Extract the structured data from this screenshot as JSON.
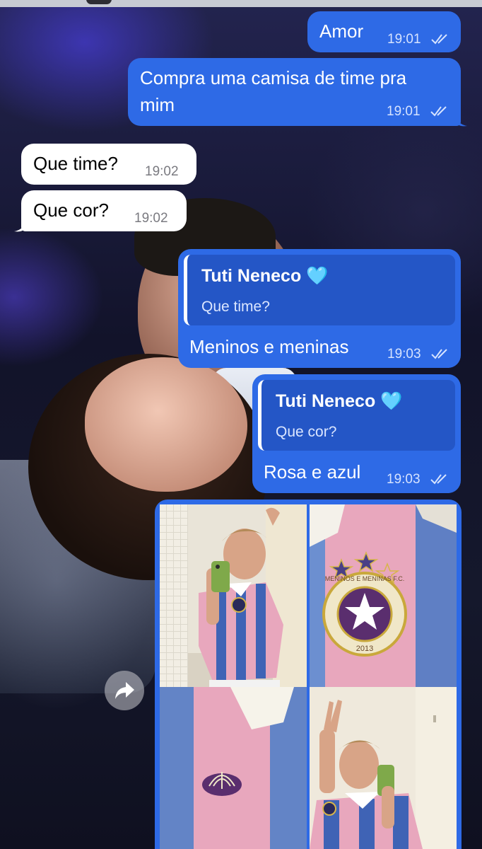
{
  "chat": {
    "messages": [
      {
        "text": "Amor",
        "time": "19:01"
      },
      {
        "text": "Compra uma camisa de time pra mim",
        "line1": "Compra uma camisa de time pra",
        "line2": "mim",
        "time": "19:01"
      },
      {
        "text": "Que time?",
        "time": "19:02"
      },
      {
        "text": "Que cor?",
        "time": "19:02"
      },
      {
        "reply_name": "Tuti Neneco 🩵",
        "reply_text": "Que time?",
        "text": "Meninos e meninas",
        "time": "19:03"
      },
      {
        "reply_name": "Tuti Neneco 🩵",
        "reply_text": "Que cor?",
        "text": "Rosa e azul",
        "time": "19:03"
      }
    ],
    "media": {
      "badge_text": "MENINOS E MENINAS F.C.",
      "badge_year": "2013"
    }
  },
  "icons": [
    "double-check-icon",
    "forward-icon",
    "adidas-logo-icon",
    "club-crest-icon",
    "star-icon",
    "phone-icon"
  ],
  "colors": {
    "outgoing_bubble": "#2e6ae6",
    "incoming_bubble": "#ffffff",
    "shirt_pink": "#e8a7bd",
    "shirt_blue": "#3f63b5"
  }
}
